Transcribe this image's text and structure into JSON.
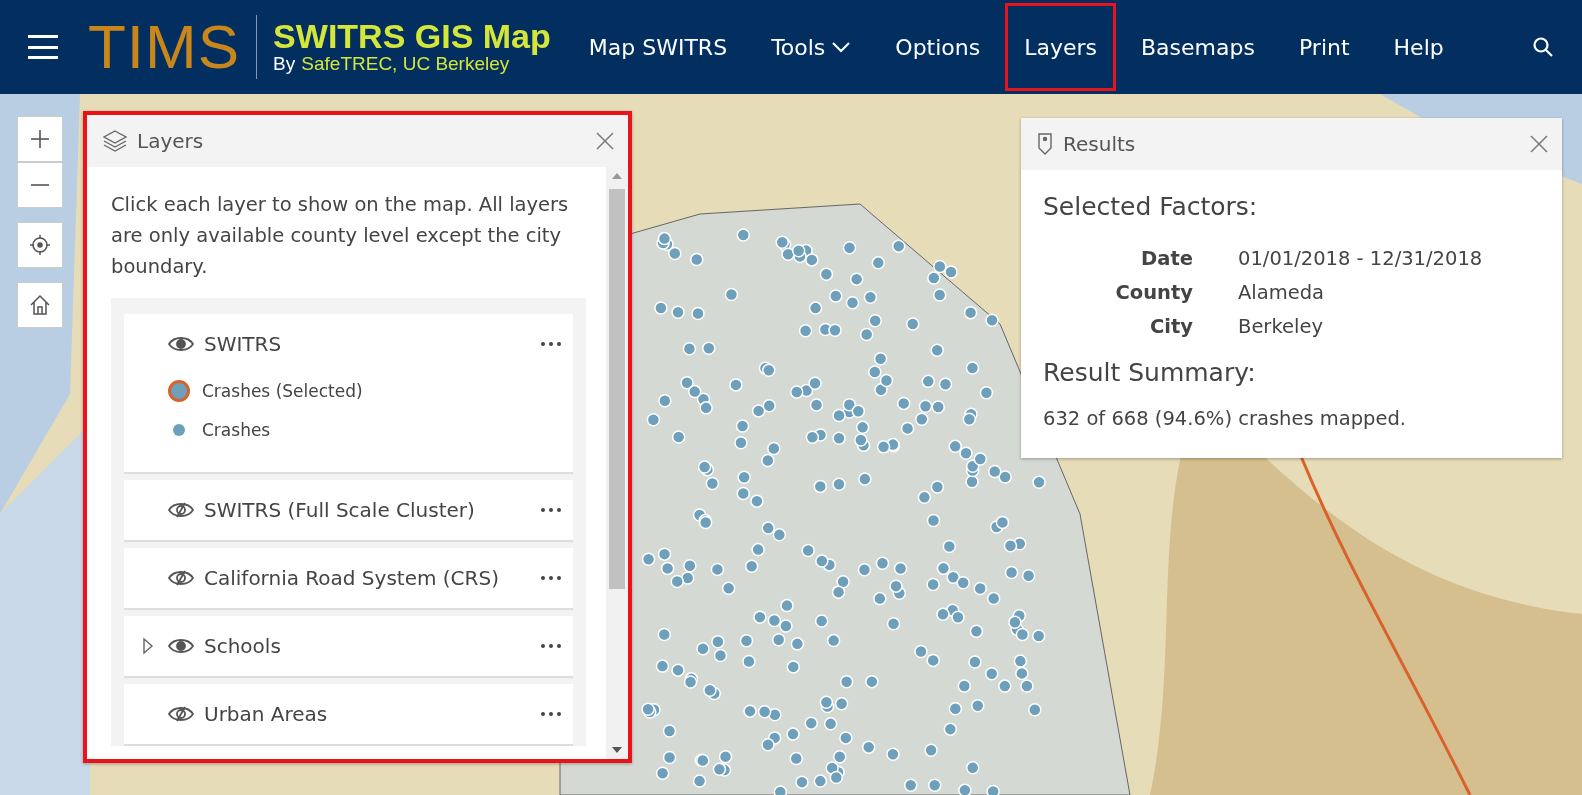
{
  "header": {
    "brand": "TIMS",
    "app_title": "SWITRS GIS Map",
    "byline_prefix": "By",
    "byline_org": "SafeTREC, UC Berkeley",
    "nav": [
      {
        "label": "Map SWITRS",
        "kind": "link",
        "highlighted": false
      },
      {
        "label": "Tools",
        "kind": "dropdown",
        "highlighted": false
      },
      {
        "label": "Options",
        "kind": "link",
        "highlighted": false
      },
      {
        "label": "Layers",
        "kind": "link",
        "highlighted": true
      },
      {
        "label": "Basemaps",
        "kind": "link",
        "highlighted": false
      },
      {
        "label": "Print",
        "kind": "link",
        "highlighted": false
      },
      {
        "label": "Help",
        "kind": "link",
        "highlighted": false
      }
    ]
  },
  "layers_panel": {
    "title": "Layers",
    "highlighted": true,
    "description": "Click each layer to show on the map. All layers are only available county level except the city boundary.",
    "layers": [
      {
        "name": "SWITRS",
        "visible": true,
        "collapsible": false,
        "legend": [
          {
            "label": "Crashes (Selected)",
            "kind": "selected"
          },
          {
            "label": "Crashes",
            "kind": "normal"
          }
        ]
      },
      {
        "name": "SWITRS (Full Scale Cluster)",
        "visible": false,
        "collapsible": false
      },
      {
        "name": "California Road System (CRS)",
        "visible": false,
        "collapsible": false
      },
      {
        "name": "Schools",
        "visible": true,
        "collapsible": true
      },
      {
        "name": "Urban Areas",
        "visible": false,
        "collapsible": false
      }
    ]
  },
  "results_panel": {
    "title": "Results",
    "factors_heading": "Selected Factors:",
    "factors": [
      {
        "label": "Date",
        "value": "01/01/2018 - 12/31/2018"
      },
      {
        "label": "County",
        "value": "Alameda"
      },
      {
        "label": "City",
        "value": "Berkeley"
      }
    ],
    "summary_heading": "Result Summary:",
    "summary": "632 of 668 (94.6%) crashes mapped."
  }
}
